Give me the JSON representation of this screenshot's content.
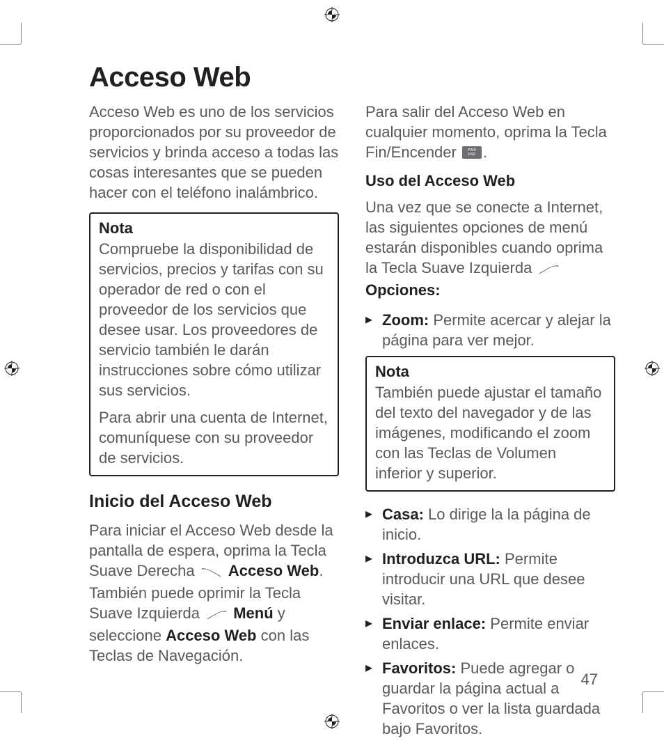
{
  "title": "Acceso Web",
  "page_number": "47",
  "col1": {
    "intro": "Acceso Web es uno de los servicios proporcionados por su proveedor de servicios y brinda acceso a todas las cosas interesantes que se pueden hacer con el teléfono inalámbrico.",
    "note1_title": "Nota",
    "note1_p1": "Compruebe la disponibilidad de servicios, precios y tarifas con su operador de red o con el proveedor de los servicios que desee usar. Los proveedores de servicio también le darán instrucciones sobre cómo utilizar sus servicios.",
    "note1_p2": "Para abrir una cuenta de Internet, comuníquese con su proveedor de servicios.",
    "h2": "Inicio del Acceso Web",
    "start_pre": "Para iniciar el Acceso Web desde la pantalla de espera, oprima la Tecla Suave Derecha ",
    "start_b1": "Acceso Web",
    "start_mid": ". También puede oprimir la Tecla Suave Izquierda ",
    "start_b2": "Menú",
    "start_mid2": " y seleccione ",
    "start_b3": "Acceso Web",
    "start_end": " con las Teclas de Navegación."
  },
  "col2": {
    "exit_pre": "Para salir del Acceso Web en cualquier momento, oprima la Tecla Fin/Encender ",
    "exit_post": ".",
    "h3": "Uso del Acceso Web",
    "use_pre": "Una vez que se conecte a Internet, las siguientes opciones de menú estarán disponibles cuando oprima la Tecla Suave Izquierda ",
    "use_b": "Opciones:",
    "zoom_b": "Zoom:",
    "zoom_t": " Permite acercar y alejar la página para ver mejor.",
    "note2_title": "Nota",
    "note2_body": "También puede ajustar el tamaño del texto del navegador y de las imágenes, modificando el zoom con las Teclas de Volumen inferior y superior.",
    "casa_b": "Casa:",
    "casa_t": " Lo dirige la la página de inicio.",
    "url_b": "Introduzca URL:",
    "url_t": " Permite introducir una URL que desee visitar.",
    "enviar_b": "Enviar enlace:",
    "enviar_t": " Permite enviar enlaces.",
    "fav_b": "Favoritos:",
    "fav_t": " Puede agregar o guardar la página actual a Favoritos o ver la lista guardada bajo Favoritos."
  }
}
